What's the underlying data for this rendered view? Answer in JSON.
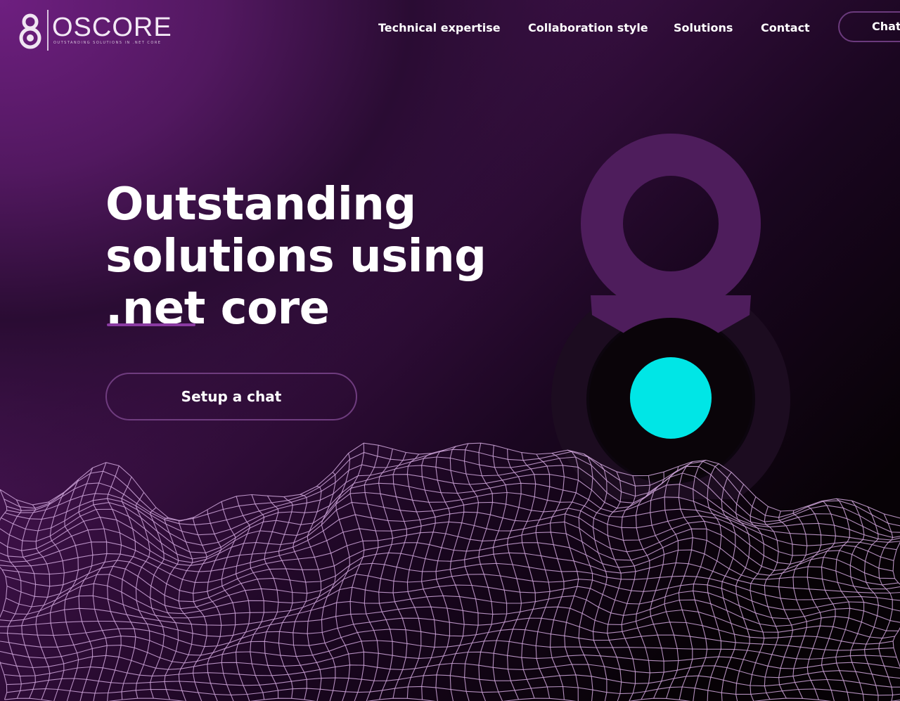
{
  "brand": {
    "name": "OSCORE",
    "tagline": "OUTSTANDING SOLUTIONS IN .NET CORE"
  },
  "nav": {
    "items": [
      {
        "label": "Technical expertise"
      },
      {
        "label": "Collaboration style"
      },
      {
        "label": "Solutions"
      },
      {
        "label": "Contact"
      }
    ],
    "cta_label": "Chat"
  },
  "hero": {
    "title_lines": [
      "Outstanding",
      "solutions using",
      ".net core"
    ],
    "cta_label": "Setup a chat"
  },
  "colors": {
    "accent_cyan": "#00e6e6",
    "brand_purple": "#5a1a6a",
    "emblem_purple": "#4e1d5c",
    "emblem_dark": "#2a1430",
    "mesh": "#cfa6da"
  },
  "icons": {
    "logo": "oscore-logo-icon",
    "emblem": "oscore-emblem-icon"
  }
}
